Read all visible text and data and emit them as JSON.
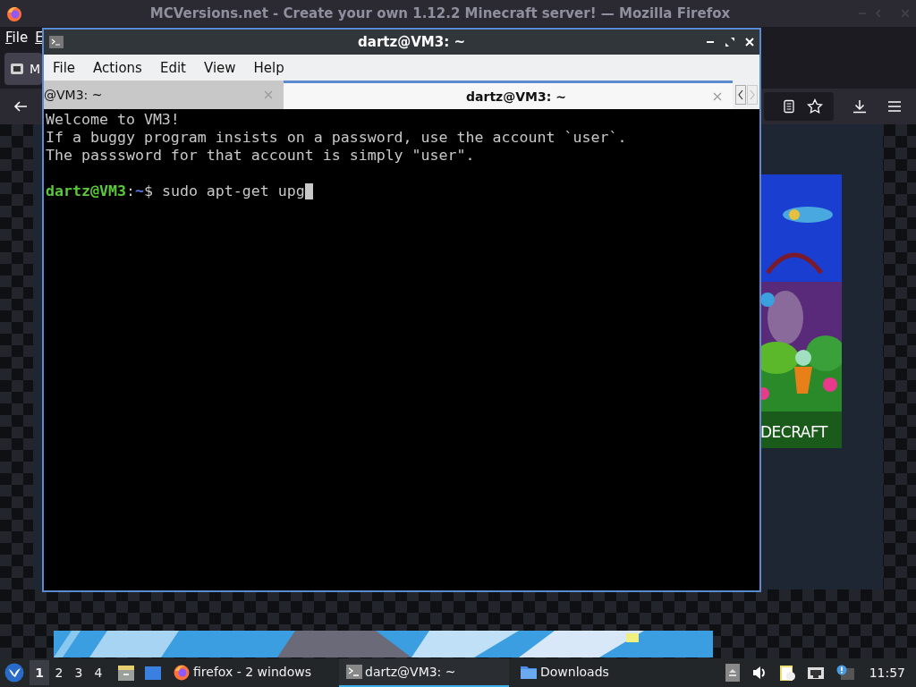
{
  "browser": {
    "title": "MCVersions.net - Create your own 1.12.2 Minecraft server! — Mozilla Firefox",
    "menu": [
      "File",
      "E"
    ],
    "tab": {
      "label": "M"
    },
    "ad": {
      "kind": "picture",
      "caption": "DECRAFT"
    }
  },
  "terminal": {
    "title": "dartz@VM3: ~",
    "menu": [
      "File",
      "Actions",
      "Edit",
      "View",
      "Help"
    ],
    "tabs": [
      {
        "label": "@VM3: ~",
        "selected": false
      },
      {
        "label": "dartz@VM3: ~",
        "selected": true
      }
    ],
    "lines": [
      "Welcome to VM3!",
      "If a buggy program insists on a password, use the account `user`.",
      "The passsword for that account is simply \"user\"."
    ],
    "prompt": {
      "user": "dartz@VM3",
      "separator": ":",
      "path": "~",
      "symbol": "$",
      "command": "sudo apt-get upg"
    }
  },
  "taskbar": {
    "workspaces": [
      {
        "label": "1",
        "selected": true
      },
      {
        "label": "2",
        "selected": false
      },
      {
        "label": "3",
        "selected": false
      },
      {
        "label": "4",
        "selected": false
      }
    ],
    "tasks": [
      {
        "kind": "firefox",
        "label": "firefox - 2 windows",
        "selected": false
      },
      {
        "kind": "terminal",
        "label": "dartz@VM3: ~",
        "selected": true
      },
      {
        "kind": "folder",
        "label": "Downloads",
        "selected": false
      }
    ],
    "clock": "11:57"
  }
}
